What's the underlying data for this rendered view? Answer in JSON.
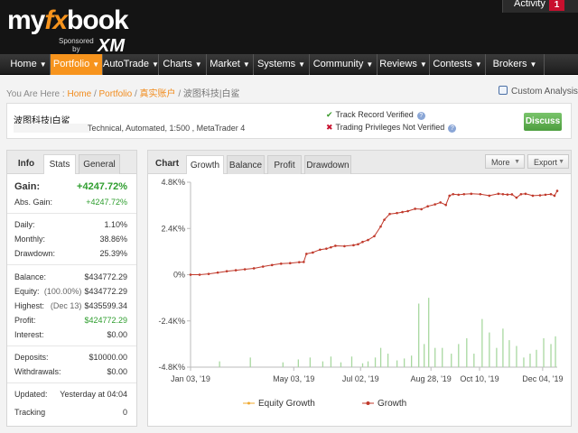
{
  "header": {
    "logo": {
      "prefix": "my",
      "fx": "fx",
      "suffix": "book",
      "sponsored": "Sponsored",
      "by": "by",
      "sponsor": "XM"
    },
    "activity_label": "Activity",
    "activity_count": "1"
  },
  "nav": [
    {
      "label": "Home",
      "active": false
    },
    {
      "label": "Portfolio",
      "active": true
    },
    {
      "label": "AutoTrade",
      "active": false
    },
    {
      "label": "Charts",
      "active": false
    },
    {
      "label": "Market",
      "active": false
    },
    {
      "label": "Systems",
      "active": false
    },
    {
      "label": "Community",
      "active": false
    },
    {
      "label": "Reviews",
      "active": false
    },
    {
      "label": "Contests",
      "active": false
    },
    {
      "label": "Brokers",
      "active": false
    }
  ],
  "breadcrumb": {
    "prefix": "You Are Here :",
    "items": [
      "Home",
      "Portfolio",
      "真实账户"
    ],
    "current": "波图科技|白鲨",
    "sep": "/"
  },
  "custom_analysis": "Custom Analysis",
  "account": {
    "name": "波图科技|白鲨",
    "description": "Technical, Automated, 1:500 , MetaTrader 4",
    "track_record": "Track Record Verified",
    "trading_privileges": "Trading Privileges Not Verified",
    "discuss": "Discuss"
  },
  "info": {
    "tabs": [
      "Info",
      "Stats",
      "General"
    ],
    "gain": {
      "label": "Gain:",
      "value": "+4247.72%"
    },
    "abs_gain": {
      "label": "Abs. Gain:",
      "value": "+4247.72%"
    },
    "daily": {
      "label": "Daily:",
      "value": "1.10%"
    },
    "monthly": {
      "label": "Monthly:",
      "value": "38.86%"
    },
    "drawdown": {
      "label": "Drawdown:",
      "value": "25.39%"
    },
    "balance": {
      "label": "Balance:",
      "value": "$434772.29"
    },
    "equity": {
      "label": "Equity:",
      "sub": "(100.00%)",
      "value": "$434772.29"
    },
    "highest": {
      "label": "Highest:",
      "sub": "(Dec 13)",
      "value": "$435599.34"
    },
    "profit": {
      "label": "Profit:",
      "value": "$424772.29"
    },
    "interest": {
      "label": "Interest:",
      "value": "$0.00"
    },
    "deposits": {
      "label": "Deposits:",
      "value": "$10000.00"
    },
    "withdrawals": {
      "label": "Withdrawals:",
      "value": "$0.00"
    },
    "updated": {
      "label": "Updated:",
      "value": "Yesterday at 04:04"
    },
    "tracking": {
      "label": "Tracking",
      "value": "0"
    }
  },
  "chart_panel": {
    "title": "Chart",
    "tabs": [
      "Growth",
      "Balance",
      "Profit",
      "Drawdown"
    ],
    "more_label": "More",
    "export_label": "Export"
  },
  "chart_data": {
    "type": "line",
    "title": "",
    "xlabel": "",
    "ylabel": "",
    "ylim": [
      -4800,
      4800
    ],
    "yticks": [
      {
        "value": 4800,
        "label": "4.8K%"
      },
      {
        "value": 2400,
        "label": "2.4K%"
      },
      {
        "value": 0,
        "label": "0%"
      },
      {
        "value": -2400,
        "label": "-2.4K%"
      },
      {
        "value": -4800,
        "label": "-4.8K%"
      }
    ],
    "xticks": [
      "Jan 03, '19",
      "May 03, '19",
      "Jul 02, '19",
      "Aug 28, '19",
      "Oct 10, '19",
      "Dec 04, '19"
    ],
    "xtick_index": [
      0,
      85,
      140,
      198,
      238,
      290
    ],
    "num_points": 302,
    "series": [
      {
        "name": "Growth",
        "color": "#c0392b",
        "points": [
          [
            0,
            0
          ],
          [
            10,
            0
          ],
          [
            20,
            40
          ],
          [
            30,
            110
          ],
          [
            40,
            180
          ],
          [
            50,
            230
          ],
          [
            60,
            280
          ],
          [
            70,
            330
          ],
          [
            80,
            420
          ],
          [
            90,
            500
          ],
          [
            100,
            570
          ],
          [
            110,
            600
          ],
          [
            120,
            650
          ],
          [
            125,
            660
          ],
          [
            128,
            1080
          ],
          [
            135,
            1150
          ],
          [
            143,
            1300
          ],
          [
            150,
            1350
          ],
          [
            155,
            1420
          ],
          [
            160,
            1500
          ],
          [
            170,
            1480
          ],
          [
            180,
            1530
          ],
          [
            185,
            1580
          ],
          [
            190,
            1700
          ],
          [
            196,
            1800
          ],
          [
            203,
            2000
          ],
          [
            210,
            2500
          ],
          [
            214,
            2850
          ],
          [
            220,
            3150
          ],
          [
            228,
            3200
          ],
          [
            234,
            3250
          ],
          [
            240,
            3300
          ],
          [
            248,
            3420
          ],
          [
            255,
            3400
          ],
          [
            262,
            3550
          ],
          [
            270,
            3650
          ],
          [
            276,
            3750
          ],
          [
            282,
            3620
          ],
          [
            286,
            4100
          ],
          [
            290,
            4180
          ],
          [
            296,
            4150
          ],
          [
            302,
            4180
          ],
          [
            310,
            4200
          ],
          [
            320,
            4180
          ],
          [
            330,
            4100
          ],
          [
            340,
            4200
          ],
          [
            345,
            4180
          ],
          [
            350,
            4160
          ],
          [
            355,
            4170
          ],
          [
            360,
            4000
          ],
          [
            365,
            4180
          ],
          [
            370,
            4200
          ],
          [
            378,
            4100
          ],
          [
            386,
            4120
          ],
          [
            392,
            4150
          ],
          [
            398,
            4180
          ],
          [
            402,
            4100
          ],
          [
            405,
            4350
          ]
        ]
      },
      {
        "name": "Equity Growth",
        "color": "#f0a82e"
      }
    ],
    "volume_bars": [
      {
        "i": 32,
        "v": 300
      },
      {
        "i": 66,
        "v": 500
      },
      {
        "i": 102,
        "v": 250
      },
      {
        "i": 119,
        "v": 400
      },
      {
        "i": 132,
        "v": 500
      },
      {
        "i": 146,
        "v": 300
      },
      {
        "i": 155,
        "v": 550
      },
      {
        "i": 166,
        "v": 250
      },
      {
        "i": 178,
        "v": 550
      },
      {
        "i": 190,
        "v": 200
      },
      {
        "i": 196,
        "v": 300
      },
      {
        "i": 204,
        "v": 500
      },
      {
        "i": 210,
        "v": 1000
      },
      {
        "i": 218,
        "v": 700
      },
      {
        "i": 228,
        "v": 350
      },
      {
        "i": 236,
        "v": 450
      },
      {
        "i": 244,
        "v": 600
      },
      {
        "i": 252,
        "v": 3300
      },
      {
        "i": 258,
        "v": 1200
      },
      {
        "i": 263,
        "v": 3600
      },
      {
        "i": 270,
        "v": 1000
      },
      {
        "i": 278,
        "v": 1000
      },
      {
        "i": 288,
        "v": 700
      },
      {
        "i": 296,
        "v": 1200
      },
      {
        "i": 305,
        "v": 1500
      },
      {
        "i": 313,
        "v": 700
      },
      {
        "i": 322,
        "v": 2500
      },
      {
        "i": 330,
        "v": 1800
      },
      {
        "i": 338,
        "v": 1000
      },
      {
        "i": 345,
        "v": 2000
      },
      {
        "i": 352,
        "v": 1400
      },
      {
        "i": 360,
        "v": 1100
      },
      {
        "i": 368,
        "v": 500
      },
      {
        "i": 375,
        "v": 700
      },
      {
        "i": 382,
        "v": 900
      },
      {
        "i": 390,
        "v": 1500
      },
      {
        "i": 398,
        "v": 1200
      },
      {
        "i": 403,
        "v": 1600
      }
    ],
    "legend": [
      "Equity Growth",
      "Growth"
    ],
    "legend_position": "bottom",
    "grid": false
  }
}
